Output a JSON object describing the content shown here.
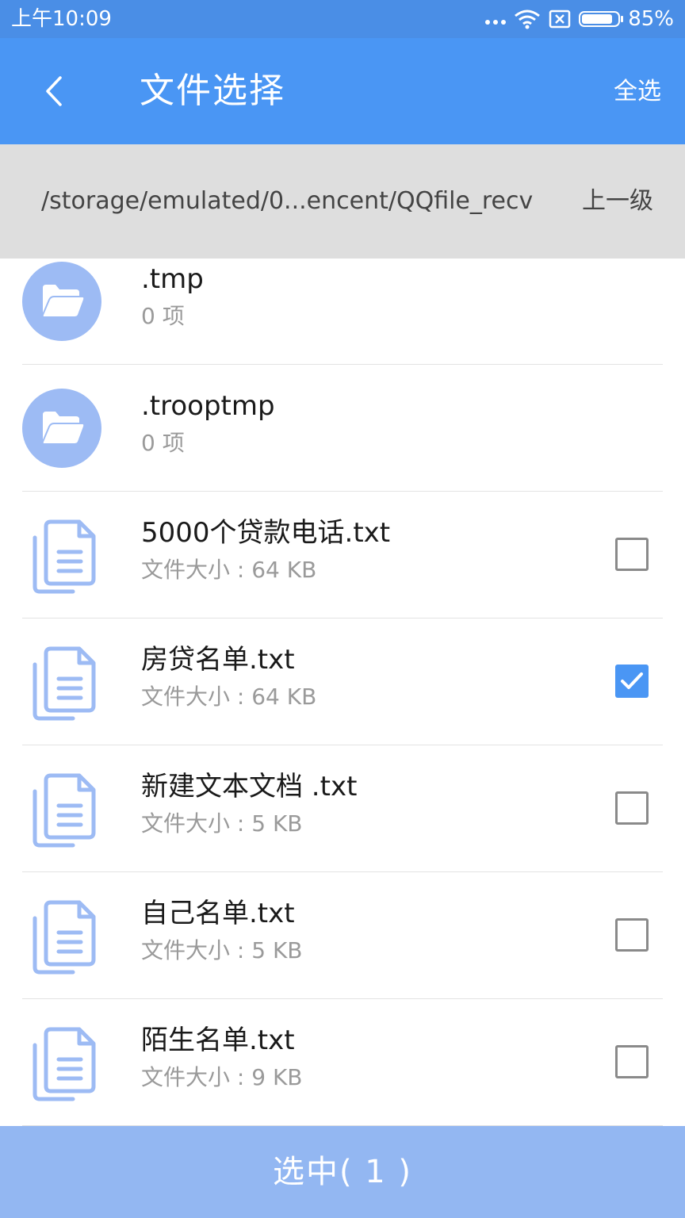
{
  "status_bar": {
    "time": "上午10:09",
    "battery_percent": "85%",
    "battery_level": 0.85,
    "icons": [
      "more-dots-icon",
      "wifi-icon",
      "no-sim-icon",
      "battery-icon"
    ]
  },
  "header": {
    "title": "文件选择",
    "select_all_label": "全选",
    "back_icon": "chevron-left-icon"
  },
  "path_bar": {
    "path": "/storage/emulated/0...encent/QQfile_recv",
    "up_level_label": "上一级"
  },
  "files": [
    {
      "type": "folder",
      "name": ".tmp",
      "sub": "0 项",
      "icon": "folder-icon"
    },
    {
      "type": "folder",
      "name": ".trooptmp",
      "sub": "0 项",
      "icon": "folder-icon"
    },
    {
      "type": "file",
      "name": "5000个贷款电话.txt",
      "sub": "文件大小 : 64 KB",
      "checked": false,
      "icon": "document-icon"
    },
    {
      "type": "file",
      "name": "房贷名单.txt",
      "sub": "文件大小 : 64 KB",
      "checked": true,
      "icon": "document-icon"
    },
    {
      "type": "file",
      "name": "新建文本文档 .txt",
      "sub": "文件大小 : 5 KB",
      "checked": false,
      "icon": "document-icon"
    },
    {
      "type": "file",
      "name": "自己名单.txt",
      "sub": "文件大小 : 5 KB",
      "checked": false,
      "icon": "document-icon"
    },
    {
      "type": "file",
      "name": "陌生名单.txt",
      "sub": "文件大小 : 9 KB",
      "checked": false,
      "icon": "document-icon"
    }
  ],
  "footer": {
    "selected_label": "选中( 1 )"
  },
  "colors": {
    "status_bar": "#4a8ee6",
    "app_bar": "#4a96f4",
    "path_bar": "#dedede",
    "icon_blue": "#9dbbf4",
    "footer": "#93b7f2",
    "checkbox_checked": "#4a96f4"
  }
}
